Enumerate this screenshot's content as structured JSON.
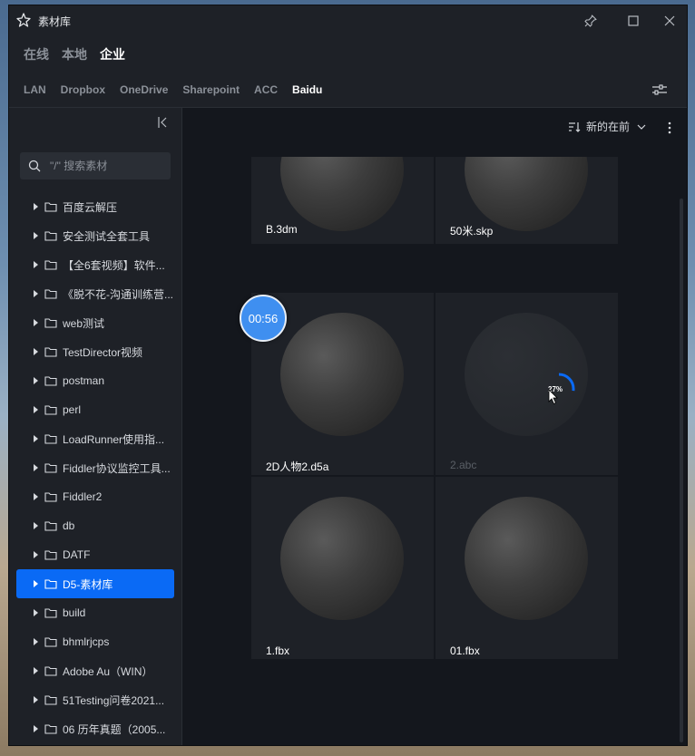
{
  "window": {
    "title": "素材库"
  },
  "source_tabs": [
    {
      "label": "在线",
      "active": false
    },
    {
      "label": "本地",
      "active": false
    },
    {
      "label": "企业",
      "active": true
    }
  ],
  "cloud_tabs": [
    {
      "label": "LAN",
      "active": false
    },
    {
      "label": "Dropbox",
      "active": false
    },
    {
      "label": "OneDrive",
      "active": false
    },
    {
      "label": "Sharepoint",
      "active": false
    },
    {
      "label": "ACC",
      "active": false
    },
    {
      "label": "Baidu",
      "active": true
    }
  ],
  "search": {
    "placeholder": "\"/\" 搜索素材"
  },
  "folders": [
    {
      "name": "百度云解压"
    },
    {
      "name": "安全测试全套工具"
    },
    {
      "name": "【全6套视频】软件..."
    },
    {
      "name": "《脱不花-沟通训练营..."
    },
    {
      "name": "web测试"
    },
    {
      "name": "TestDirector视频"
    },
    {
      "name": "postman"
    },
    {
      "name": "perl"
    },
    {
      "name": "LoadRunner使用指..."
    },
    {
      "name": "Fiddler协议监控工具..."
    },
    {
      "name": "Fiddler2"
    },
    {
      "name": "db"
    },
    {
      "name": "DATF"
    },
    {
      "name": "D5-素材库",
      "selected": true
    },
    {
      "name": "build"
    },
    {
      "name": "bhmlrjcps"
    },
    {
      "name": "Adobe Au（WIN）"
    },
    {
      "name": "51Testing问卷2021..."
    },
    {
      "name": "06 历年真题（2005..."
    }
  ],
  "sort": {
    "label": "新的在前"
  },
  "assets": [
    {
      "name": "B.3dm"
    },
    {
      "name": "50米.skp"
    },
    {
      "name": "2D人物2.d5a"
    },
    {
      "name": "2.abc",
      "loading": true,
      "progress_text": "27%",
      "progress": 0.27
    },
    {
      "name": "1.fbx"
    },
    {
      "name": "01.fbx"
    }
  ],
  "timer": {
    "label": "00:56"
  },
  "colors": {
    "accent": "#0a6af5",
    "background": "#1e2127",
    "content_bg": "#14171d"
  }
}
